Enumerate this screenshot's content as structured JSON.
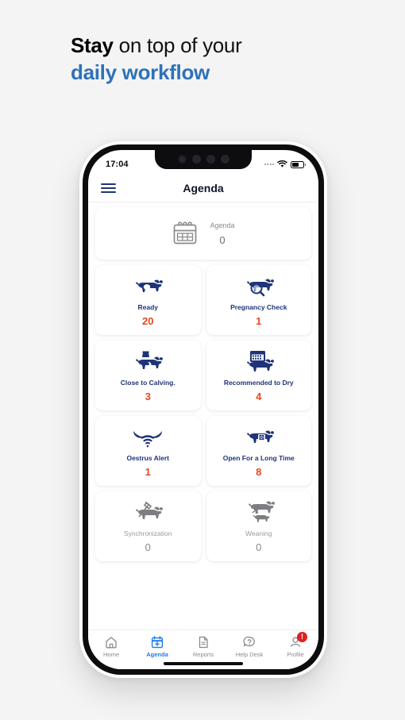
{
  "marketing": {
    "headline_bold": "Stay",
    "headline_rest": " on top of your",
    "headline_accent": "daily workflow",
    "accent_color": "#2e72b8"
  },
  "status_bar": {
    "time": "17:04",
    "signal_icon": "signal-dots-icon",
    "wifi_icon": "wifi-icon",
    "battery_icon": "battery-icon"
  },
  "header": {
    "menu_icon": "hamburger-menu-icon",
    "title": "Agenda"
  },
  "agenda_summary": {
    "icon": "calendar-icon",
    "label": "Agenda",
    "value": "0"
  },
  "tiles": [
    {
      "label": "Ready",
      "value": "20",
      "icon": "cow-icon",
      "state": "active"
    },
    {
      "label": "Pregnancy Check",
      "value": "1",
      "icon": "cow-magnifier-icon",
      "state": "active"
    },
    {
      "label": "Close to Calving.",
      "value": "3",
      "icon": "cow-calving-icon",
      "state": "active"
    },
    {
      "label": "Recommended to Dry",
      "value": "4",
      "icon": "cow-calendar-icon",
      "state": "active"
    },
    {
      "label": "Oestrus Alert",
      "value": "1",
      "icon": "cow-horns-signal-icon",
      "state": "active"
    },
    {
      "label": "Open For a Long Time",
      "value": "8",
      "icon": "cow-clock-icon",
      "state": "active"
    },
    {
      "label": "Synchronization",
      "value": "0",
      "icon": "cow-syringe-icon",
      "state": "disabled"
    },
    {
      "label": "Weaning",
      "value": "0",
      "icon": "cow-calf-icon",
      "state": "disabled"
    }
  ],
  "colors": {
    "tile_label": "#1f3478",
    "tile_value": "#e8491e",
    "disabled": "#8a8a8e",
    "nav_active": "#1d7ce8",
    "badge": "#e02020"
  },
  "bottom_nav": [
    {
      "label": "Home",
      "icon": "home-icon",
      "active": false
    },
    {
      "label": "Agenda",
      "icon": "calendar-plus-icon",
      "active": true
    },
    {
      "label": "Reports",
      "icon": "document-icon",
      "active": false
    },
    {
      "label": "Help Desk",
      "icon": "question-bubble-icon",
      "active": false
    },
    {
      "label": "Profile",
      "icon": "person-icon",
      "active": false,
      "badge": "!"
    }
  ]
}
